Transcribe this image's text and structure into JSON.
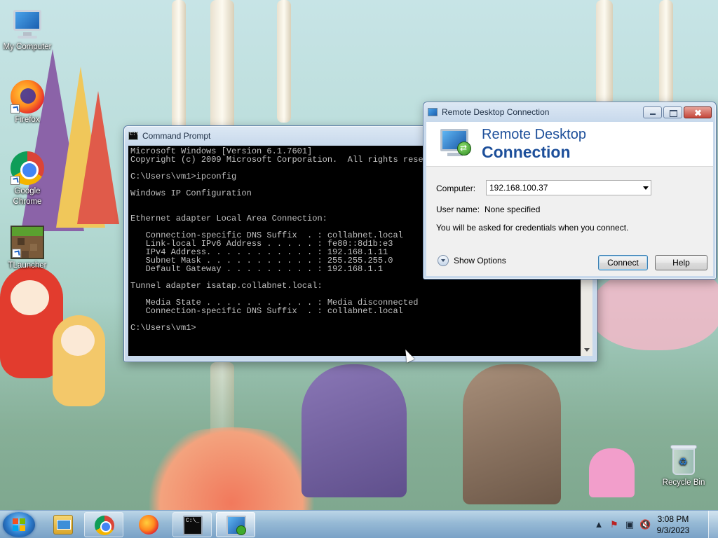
{
  "desktop": {
    "icons": [
      {
        "label": "My Computer",
        "icon": "computer-icon"
      },
      {
        "label": "Firefox",
        "icon": "firefox-icon"
      },
      {
        "label": "Google Chrome",
        "icon": "chrome-icon"
      },
      {
        "label": "TLauncher",
        "icon": "tlauncher-icon"
      },
      {
        "label": "Recycle Bin",
        "icon": "recycle-bin-icon"
      }
    ]
  },
  "cmd": {
    "title": "Command Prompt",
    "lines": [
      "Microsoft Windows [Version 6.1.7601]",
      "Copyright (c) 2009 Microsoft Corporation.  All rights reserved.",
      "",
      "C:\\Users\\vm1>ipconfig",
      "",
      "Windows IP Configuration",
      "",
      "",
      "Ethernet adapter Local Area Connection:",
      "",
      "   Connection-specific DNS Suffix  . : collabnet.local",
      "   Link-local IPv6 Address . . . . . : fe80::8d1b:e3",
      "   IPv4 Address. . . . . . . . . . . : 192.168.1.11",
      "   Subnet Mask . . . . . . . . . . . : 255.255.255.0",
      "   Default Gateway . . . . . . . . . : 192.168.1.1",
      "",
      "Tunnel adapter isatap.collabnet.local:",
      "",
      "   Media State . . . . . . . . . . . : Media disconnected",
      "   Connection-specific DNS Suffix  . : collabnet.local",
      "",
      "C:\\Users\\vm1>"
    ]
  },
  "rdc": {
    "title": "Remote Desktop Connection",
    "header_line1": "Remote Desktop",
    "header_line2": "Connection",
    "computer_label": "Computer:",
    "computer_value": "192.168.100.37",
    "username_label": "User name:",
    "username_value": "None specified",
    "credentials_note": "You will be asked for credentials when you connect.",
    "show_options": "Show Options",
    "connect_label": "Connect",
    "help_label": "Help"
  },
  "taskbar": {
    "time": "3:08 PM",
    "date": "9/3/2023",
    "pinned": [
      "explorer-icon",
      "chrome-icon",
      "firefox-icon",
      "command-prompt-icon",
      "remote-desktop-icon"
    ]
  },
  "colors": {
    "rdc_title": "#1d4f9a",
    "console_bg": "#000000",
    "console_fg": "#c0c0c0"
  }
}
